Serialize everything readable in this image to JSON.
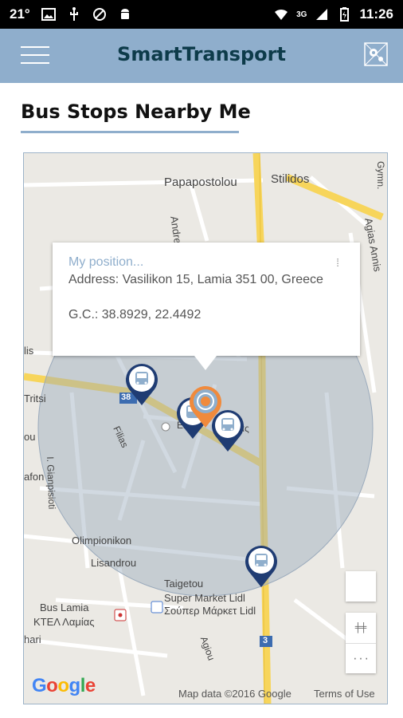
{
  "status_bar": {
    "temperature": "21°",
    "network": "3G",
    "time": "11:26"
  },
  "app_bar": {
    "title": "SmartTransport"
  },
  "section": {
    "title": "Bus Stops Nearby Me"
  },
  "map": {
    "streets": [
      {
        "name": "Papapostolou"
      },
      {
        "name": "Stilidos"
      },
      {
        "name": "Andrea Papandreou"
      },
      {
        "name": "Agias Annis"
      },
      {
        "name": "Gymn."
      },
      {
        "name": "Filias"
      },
      {
        "name": "Tritsi"
      },
      {
        "name": "I. Gianpisioti"
      },
      {
        "name": "Olimpionikon"
      },
      {
        "name": "Lisandrou"
      },
      {
        "name": "Taigetou"
      },
      {
        "name": "afon"
      },
      {
        "name": "lis"
      },
      {
        "name": "ou"
      },
      {
        "name": "hari"
      },
      {
        "name": "Agiou"
      },
      {
        "name": "Εκ"
      },
      {
        "name": "ας"
      }
    ],
    "route_badges": [
      "38",
      "3"
    ],
    "place_labels": {
      "bus_lamia": "Bus Lamia",
      "ktel_lamias": "ΚΤΕΛ Λαμίας",
      "supermarket_lidl": "Super Market Lidl",
      "souper_market_lidl": "Σούπερ Μάρκετ Lidl"
    },
    "popup": {
      "title": "My position...",
      "address": "Address: Vasilikon 15, Lamia 351 00, Greece",
      "gc": "G.C.: 38.8929, 22.4492"
    },
    "attribution": {
      "logo": "Google",
      "map_data": "Map data ©2016 Google",
      "terms": "Terms of Use"
    },
    "colors": {
      "accent": "#8faecc",
      "marker_blue": "#1f3c73",
      "marker_orange": "#f08a3c",
      "major_road": "#f7d55b",
      "radius_overlay": "#9aaabc"
    }
  }
}
